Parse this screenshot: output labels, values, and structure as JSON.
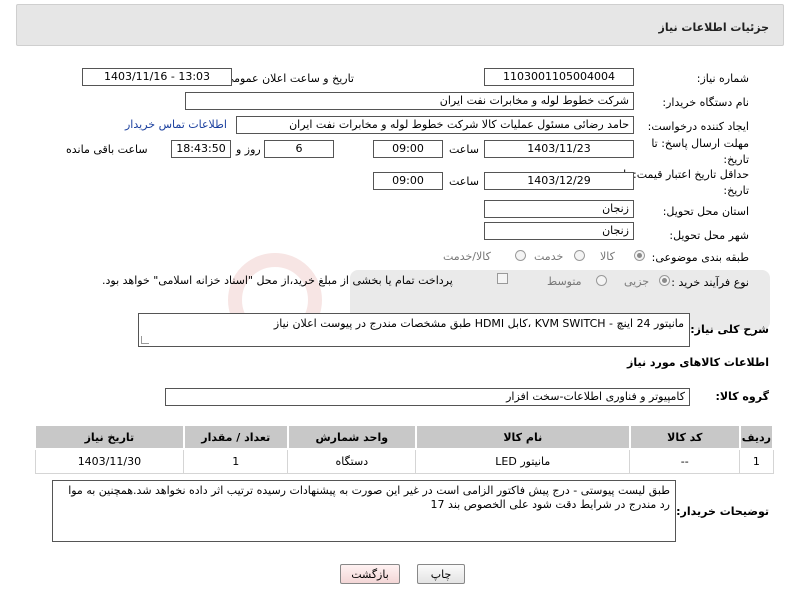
{
  "header": {
    "title": "جزئیات اطلاعات نیاز"
  },
  "fields": {
    "need_number_label": "شماره نیاز:",
    "need_number": "1103001105004004",
    "announce_label": "تاریخ و ساعت اعلان عمومی:",
    "announce_value": "1403/11/16 - 13:03",
    "buyer_org_label": "نام دستگاه خریدار:",
    "buyer_org": "شرکت خطوط لوله و مخابرات نفت ایران",
    "creator_label": "ایجاد کننده درخواست:",
    "creator": "حامد  رضائی  مسئول عملیات کالا  شرکت خطوط لوله و مخابرات نفت ایران",
    "buyer_contact_link": "اطلاعات تماس خریدار",
    "deadline_label_1": "مهلت ارسال پاسخ: تا",
    "deadline_label_2": "تاریخ:",
    "deadline_date": "1403/11/23",
    "time_label": "ساعت",
    "deadline_time": "09:00",
    "days_value": "6",
    "days_label": "روز و",
    "remaining_time": "18:43:50",
    "remaining_label": "ساعت باقی مانده",
    "validity_label_1": "حداقل تاریخ اعتبار قیمت: تا",
    "validity_label_2": "تاریخ:",
    "validity_date": "1403/12/29",
    "validity_time": "09:00",
    "province_label": "استان محل تحویل:",
    "province": "زنجان",
    "city_label": "شهر محل تحویل:",
    "city": "زنجان",
    "category_label": "طبقه بندی موضوعی:",
    "category_options": [
      "کالا",
      "خدمت",
      "کالا/خدمت"
    ],
    "category_selected": "کالا",
    "process_label": "نوع فرآیند خرید :",
    "process_options": [
      "جزیی",
      "متوسط"
    ],
    "process_selected": "جزیی",
    "payment_note": "پرداخت تمام یا بخشی از مبلغ خرید،از محل \"اسناد خزانه اسلامی\" خواهد بود."
  },
  "description": {
    "label": "شرح کلی نیاز:",
    "text": "مانیتور 24 اینچ - KVM SWITCH ،کابل HDMI طبق مشخصات مندرج در پیوست اعلان نیاز"
  },
  "goods_info": {
    "title": "اطلاعات کالاهای مورد نیاز",
    "group_label": "گروه کالا:",
    "group_value": "کامپیوتر و فناوری اطلاعات-سخت افزار"
  },
  "table": {
    "headers": [
      "ردیف",
      "کد کالا",
      "نام کالا",
      "واحد شمارش",
      "تعداد / مقدار",
      "تاریخ نیاز"
    ],
    "rows": [
      {
        "row": "1",
        "code": "--",
        "name": "مانیتور LED",
        "unit": "دستگاه",
        "qty": "1",
        "date": "1403/11/30"
      }
    ]
  },
  "buyer_notes": {
    "label": "توضیحات خریدار:",
    "text": "طبق لیست پیوستی - درج پیش فاکتور الزامی است در غیر این صورت به پیشنهادات رسیده ترتیب اثر داده نخواهد شد.همچنین به موا رد مندرج در شرایط دقت شود علی الخصوص بند 17"
  },
  "buttons": {
    "print": "چاپ",
    "back": "بازگشت"
  },
  "colors": {
    "link": "#1a3f9e",
    "header_bg": "#e6e6e6",
    "table_header_bg": "#c8c8c8"
  }
}
